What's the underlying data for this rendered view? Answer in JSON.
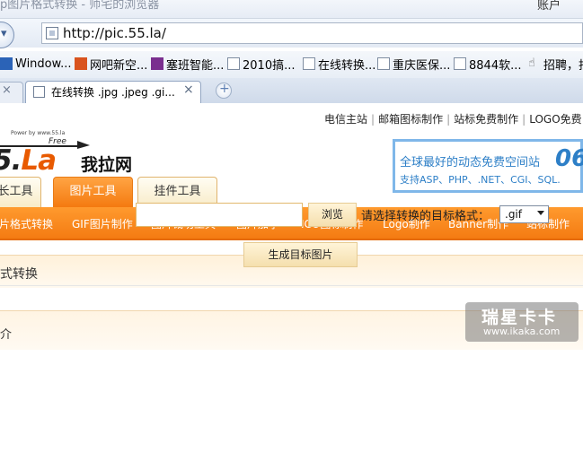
{
  "browser": {
    "title": "p图片格式转换 - 师宅的浏览器",
    "title_right": "账户",
    "url": "http://pic.55.la/",
    "bookmarks": [
      {
        "label": "Window...",
        "icon": "windows7-icon",
        "color": "#2b63b7"
      },
      {
        "label": "网吧新空...",
        "icon": "netbar-icon",
        "color": "#d9531e"
      },
      {
        "label": "塞班智能...",
        "icon": "symbian-icon",
        "color": "#7a2f8f"
      },
      {
        "label": "2010搞...",
        "icon": "page-icon",
        "color": "#7f8da1"
      },
      {
        "label": "在线转换...",
        "icon": "page-icon",
        "color": "#7f8da1"
      },
      {
        "label": "重庆医保...",
        "icon": "page-icon",
        "color": "#7f8da1"
      },
      {
        "label": "8844软...",
        "icon": "page-icon",
        "color": "#7f8da1"
      },
      {
        "label": "招聘，找",
        "icon": "hand-icon",
        "color": "#555555"
      }
    ],
    "tab_active_label": "在线转换 .jpg .jpeg .gi...",
    "tab_close": "×",
    "tab_new": "+"
  },
  "site": {
    "toplinks": [
      "电信主站",
      "邮箱图标制作",
      "站标免费制作",
      "LOGO免费"
    ],
    "logo": {
      "slogan": "Power by www.55.la",
      "free": "Free",
      "main_prefix": "5.",
      "main_accent": "La",
      "cn": "我拉网"
    },
    "ad": {
      "line1": "全球最好的动态免费空间站",
      "number": "06",
      "line2": "支持ASP、PHP、.NET、CGI、SQL."
    },
    "main_tabs": [
      "长工具",
      "图片工具",
      "挂件工具"
    ],
    "subnav": [
      "片格式转换",
      "GIF图片制作",
      "图片裁切工具",
      "图片加字",
      "ICO图标制作",
      "Logo制作",
      "Banner制作",
      "站标制作"
    ],
    "section_title": "式转换",
    "browse_label": "浏览",
    "format_label": "请选择转换的目标格式：",
    "format_value": ".gif",
    "generate_label": "生成目标图片",
    "intro_title": "介"
  },
  "watermark": {
    "cn": "瑞星卡卡",
    "url": "www.ikaka.com"
  }
}
